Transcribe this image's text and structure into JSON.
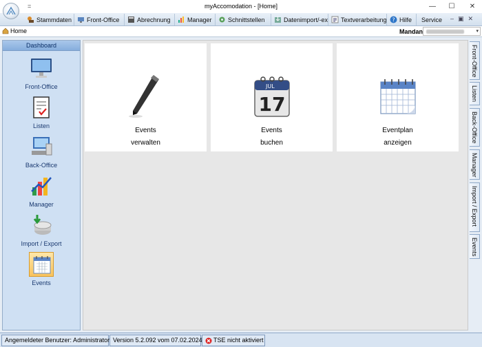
{
  "window": {
    "title": "myAccomodation - [Home]",
    "qat_glyph": "=",
    "min_glyph": "—",
    "max_glyph": "☐",
    "close_glyph": "✕"
  },
  "ribbon": {
    "tabs": [
      {
        "label": "Stammdaten",
        "icon": "stammdaten-icon"
      },
      {
        "label": "Front-Office",
        "icon": "front-office-icon"
      },
      {
        "label": "Abrechnung",
        "icon": "calculator-icon"
      },
      {
        "label": "Manager",
        "icon": "chart-icon"
      },
      {
        "label": "Schnittstellen",
        "icon": "gear-icon"
      },
      {
        "label": "Datenimport/-exp",
        "icon": "import-icon"
      },
      {
        "label": "Textverarbeitung",
        "icon": "text-icon"
      },
      {
        "label": "Hilfe",
        "icon": "help-icon"
      },
      {
        "label": "Service",
        "icon": ""
      }
    ],
    "small_icons": [
      "–",
      "▣",
      "✕"
    ]
  },
  "breadcrumb": {
    "home": "Home"
  },
  "mandant": {
    "label": "Mandant:",
    "arrow": "▾"
  },
  "sidebar": {
    "header": "Dashboard",
    "items": [
      {
        "label": "Front-Office"
      },
      {
        "label": "Listen"
      },
      {
        "label": "Back-Office"
      },
      {
        "label": "Manager"
      },
      {
        "label": "Import / Export"
      },
      {
        "label": "Events"
      }
    ]
  },
  "tiles": [
    {
      "line1": "Events",
      "line2": "verwalten"
    },
    {
      "line1": "Events",
      "line2": "buchen",
      "cal_month": "JUL",
      "cal_day": "17"
    },
    {
      "line1": "Eventplan",
      "line2": "anzeigen"
    }
  ],
  "right_tabs": [
    "Front-Office",
    "Listen",
    "Back-Office",
    "Manager",
    "Import / Export",
    "Events"
  ],
  "status": {
    "user": "Angemeldeter Benutzer: Administrator",
    "version": "Version 5.2.092 vom 07.02.2024",
    "tse": "TSE nicht aktiviert"
  },
  "colors": {
    "accent": "#86aedd",
    "sidebar_bg": "#cfe0f3",
    "selected": "#f9c35c",
    "status_error": "#d22"
  }
}
